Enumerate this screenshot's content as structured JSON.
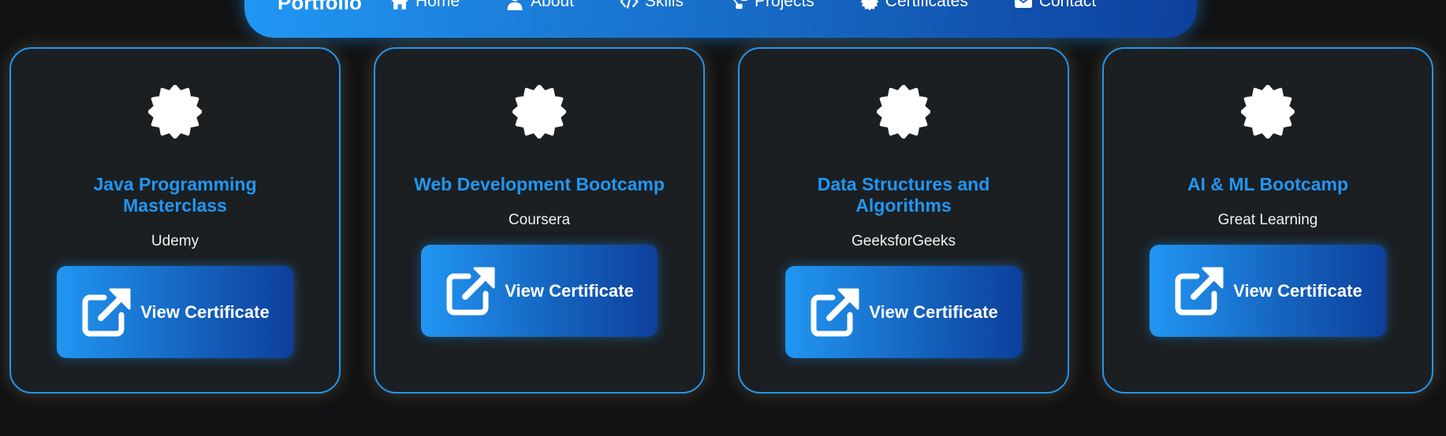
{
  "navbar": {
    "brand": "Portfolio",
    "items": [
      {
        "label": "Home",
        "icon": "home-icon"
      },
      {
        "label": "About",
        "icon": "user-icon"
      },
      {
        "label": "Skills",
        "icon": "code-icon"
      },
      {
        "label": "Projects",
        "icon": "project-diagram-icon"
      },
      {
        "label": "Certificates",
        "icon": "certificate-icon"
      },
      {
        "label": "Contact",
        "icon": "envelope-icon"
      }
    ]
  },
  "certificates": [
    {
      "title": "Java Programming Masterclass",
      "issuer": "Udemy",
      "button_label": "View Certificate",
      "icon": "certificate-icon"
    },
    {
      "title": "Web Development Bootcamp",
      "issuer": "Coursera",
      "button_label": "View Certificate",
      "icon": "certificate-icon"
    },
    {
      "title": "Data Structures and Algorithms",
      "issuer": "GeeksforGeeks",
      "button_label": "View Certificate",
      "icon": "certificate-icon"
    },
    {
      "title": "AI & ML Bootcamp",
      "issuer": "Great Learning",
      "button_label": "View Certificate",
      "icon": "certificate-icon"
    }
  ],
  "colors": {
    "accent": "#2196f3",
    "accent_dark": "#0d3f9c",
    "background": "#111213",
    "card_background": "#1b1f22"
  }
}
